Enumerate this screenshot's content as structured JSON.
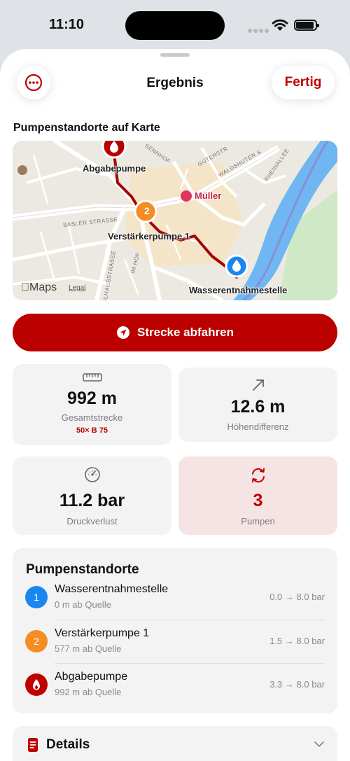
{
  "status_bar": {
    "time": "11:10"
  },
  "nav": {
    "title": "Ergebnis",
    "done_label": "Fertig",
    "more_icon": "ellipsis-circle-icon"
  },
  "map_section": {
    "title": "Pumpenstandorte auf Karte",
    "labels": {
      "pump_dispense": "Abgabepumpe",
      "pump_booster": "Verstärkerpumpe 1",
      "pump_source": "Wasserentnahmestelle",
      "poi": "Müller",
      "booster_marker_number": "2"
    },
    "streets": [
      "SENNHOF",
      "GÜTERSTR",
      "WALDSHUTER S",
      "RHEINALLEE",
      "BASLER STRASSE",
      "IM HOF",
      "ULHAUSSTRASSE"
    ],
    "attribution": {
      "logo": "Maps",
      "legal": "Legal"
    }
  },
  "drive_button": {
    "label": "Strecke abfahren",
    "icon": "location-arrow-icon"
  },
  "stats": {
    "distance": {
      "value": "992 m",
      "label": "Gesamtstrecke",
      "sub": "50× B 75",
      "icon": "ruler-icon"
    },
    "elevation": {
      "value": "12.6 m",
      "label": "Höhendifferenz",
      "icon": "arrow-up-right-icon"
    },
    "pressure": {
      "value": "11.2 bar",
      "label": "Druckverlust",
      "icon": "gauge-icon"
    },
    "pumps": {
      "value": "3",
      "label": "Pumpen",
      "icon": "cycle-arrows-icon"
    }
  },
  "pumps_card": {
    "title": "Pumpenstandorte",
    "rows": [
      {
        "badge": "1",
        "name": "Wasserentnahmestelle",
        "dist": "0 m ab Quelle",
        "pressure": "0.0 → 8.0 bar",
        "color": "#1a86f0"
      },
      {
        "badge": "2",
        "name": "Verstärkerpumpe 1",
        "dist": "577 m ab Quelle",
        "pressure": "1.5 → 8.0 bar",
        "color": "#f58c24"
      },
      {
        "badge": "",
        "name": "Abgabepumpe",
        "dist": "992 m ab Quelle",
        "pressure": "3.3 → 8.0 bar",
        "color": "#c00000"
      }
    ]
  },
  "details": {
    "label": "Details",
    "icon": "document-icon"
  },
  "colors": {
    "accent": "#c00000",
    "button": "#bb0000",
    "source": "#1a86f0",
    "booster": "#f58c24",
    "card": "#f3f3f4",
    "pink_card": "#f6e4e4"
  }
}
